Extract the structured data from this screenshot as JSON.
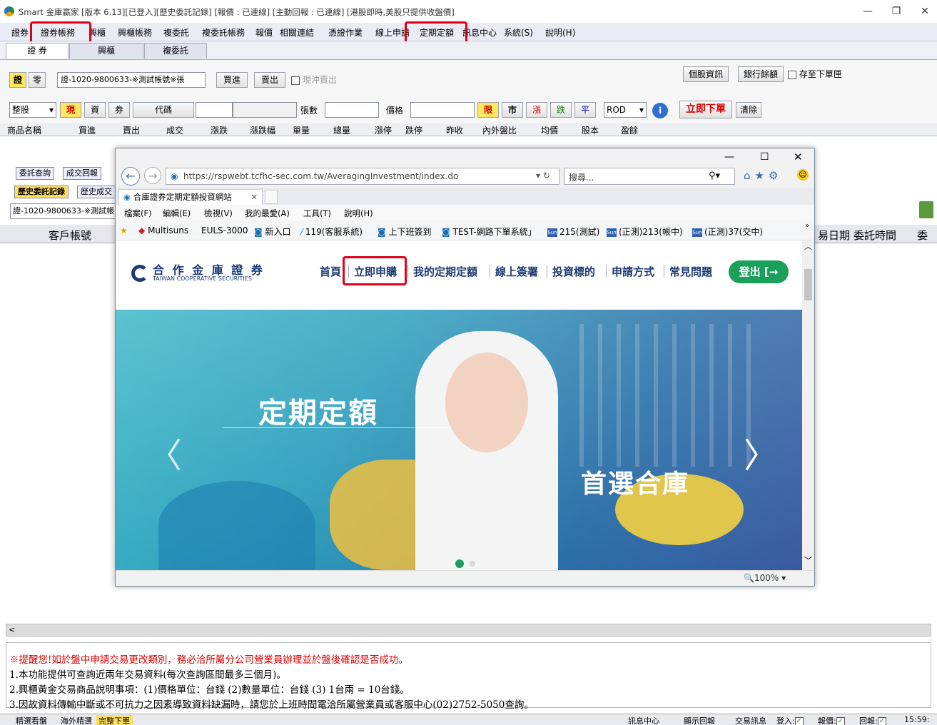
{
  "window": {
    "title": "Smart 金庫贏家 [版本 6.13][已登入][歷史委託記錄] [報價 : 已連線] [主動回報 : 已連線] [港股即時,美股只提供收盤價]"
  },
  "menubar": {
    "items": [
      "證券",
      "證券帳務",
      "興櫃",
      "興櫃帳務",
      "複委託",
      "複委託帳務",
      "報價",
      "相關連結",
      "憑證作業",
      "線上申請",
      "定期定額",
      "訊息中心",
      "系統(S)",
      "說明(H)"
    ]
  },
  "main_tabs": [
    "證 券",
    "興櫃",
    "複委託"
  ],
  "order_panel": {
    "market_tag": "證",
    "odd_tag": "零",
    "account_value": "證-1020-9800633-※測試帳號※張",
    "buy": "買進",
    "sell": "賣出",
    "offset_label": "現沖賣出",
    "stock_info": "個股資訊",
    "bank_balance": "銀行餘額",
    "save_order_label": "存至下單匣",
    "lot_type": "整股",
    "cash": "現",
    "margin": "資",
    "short": "券",
    "code_btn": "代碼",
    "shares_label": "張數",
    "price_label": "價格",
    "limit_btn": "限",
    "market_btn": "市",
    "up_btn": "漲",
    "down_btn": "跌",
    "flat_btn": "平",
    "tif_value": "ROD",
    "submit": "立即下單",
    "clear": "清除"
  },
  "quote_headers": [
    "商品名稱",
    "買進",
    "賣出",
    "成交",
    "漲跌",
    "漲跌幅",
    "單量",
    "總量",
    "漲停",
    "跌停",
    "昨收",
    "內外盤比",
    "均價",
    "股本",
    "盈餘"
  ],
  "sub_tabs": {
    "row1": [
      "委託查詢",
      "成交回報"
    ],
    "row2": [
      "歷史委託記錄",
      "歷史成交"
    ]
  },
  "history": {
    "account_value": "證-1020-9800633-※測試帳",
    "headers": [
      "客戶帳號",
      "易日期",
      "委託時間",
      "委"
    ]
  },
  "browser": {
    "url": "https://rspwebt.tcfhc-sec.com.tw/AveragingInvestment/index.do",
    "search_placeholder": "搜尋...",
    "tab_title": "合庫證券定期定額投資網站",
    "menu": [
      "檔案(F)",
      "編輯(E)",
      "檢視(V)",
      "我的最愛(A)",
      "工具(T)",
      "說明(H)"
    ],
    "favorites": [
      "Multisuns",
      "EULS-3000",
      "新入口",
      "119(客服系統)",
      "上下班簽到",
      "TEST-網路下單系統」",
      "215(測試)",
      "(正測)213(帳中)",
      "(正測)37(交中)"
    ],
    "zoom": "100%"
  },
  "site": {
    "logo_cn": "合 作 金 庫 證 券",
    "logo_en": "TAIWAN COOPERATIVE SECURITIES",
    "nav": [
      "首頁",
      "立即申購",
      "我的定期定額",
      "線上簽署",
      "投資標的",
      "申請方式",
      "常見問題"
    ],
    "logout": "登出",
    "hero_title": "定期定額",
    "hero_sub": "首選合庫"
  },
  "notes": [
    "※提醒您!如於盤中申請交易更改類別，務必洽所屬分公司營業員辦理並於盤後確認是否成功。",
    "1.本功能提供可查詢近兩年交易資料(每次查詢區間最多三個月)。",
    "2.興櫃黃金交易商品說明事項：(1)價格單位：台錢 (2)數量單位：台錢 (3) 1台兩 = 10台錢。",
    "3.因故資料傳輸中斷或不可抗力之因素導致資料缺漏時，請您於上班時間電洽所屬營業員或客服中心(02)2752-5050查詢。"
  ],
  "statusbar": {
    "left": [
      "精選看盤",
      "海外精選",
      "完整下單"
    ],
    "right": [
      "訊息中心",
      "顯示回報",
      "交易訊息",
      "登入:",
      "報價:",
      "回報:"
    ],
    "time": "15:59:"
  },
  "colors": {
    "accent_red": "#e0001b",
    "site_navy": "#1d3a73",
    "logout_green": "#1aa05a"
  }
}
